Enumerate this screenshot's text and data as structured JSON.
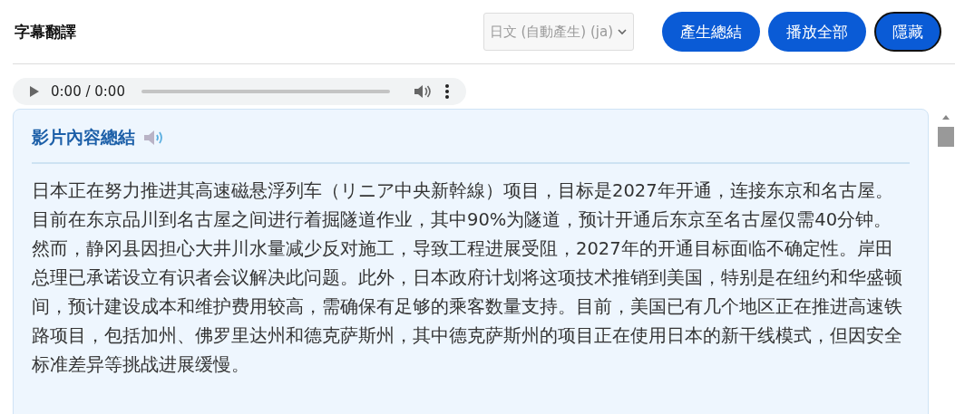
{
  "header": {
    "title": "字幕翻譯",
    "language_select": {
      "value": "日文 (自動產生) (ja)",
      "disabled": true
    },
    "buttons": [
      {
        "label": "產生總結",
        "focused": false
      },
      {
        "label": "播放全部",
        "focused": false
      },
      {
        "label": "隱藏",
        "focused": true
      }
    ]
  },
  "audio_player": {
    "time": "0:00 / 0:00"
  },
  "summary": {
    "title": "影片內容總結",
    "text": "日本正在努力推进其高速磁悬浮列车（リニア中央新幹線）项目，目标是2027年开通，连接东京和名古屋。目前在东京品川到名古屋之间进行着掘隧道作业，其中90%为隧道，预计开通后东京至名古屋仅需40分钟。然而，静冈县因担心大井川水量减少反对施工，导致工程进展受阻，2027年的开通目标面临不确定性。岸田总理已承诺设立有识者会议解决此问题。此外，日本政府计划将这项技术推销到美国，特别是在纽约和华盛顿间，预计建设成本和维护费用较高，需确保有足够的乘客数量支持。目前，美国已有几个地区正在推进高速铁路项目，包括加州、佛罗里达州和德克萨斯州，其中德克萨斯州的项目正在使用日本的新干线模式，但因安全标准差异等挑战进展缓慢。"
  }
}
